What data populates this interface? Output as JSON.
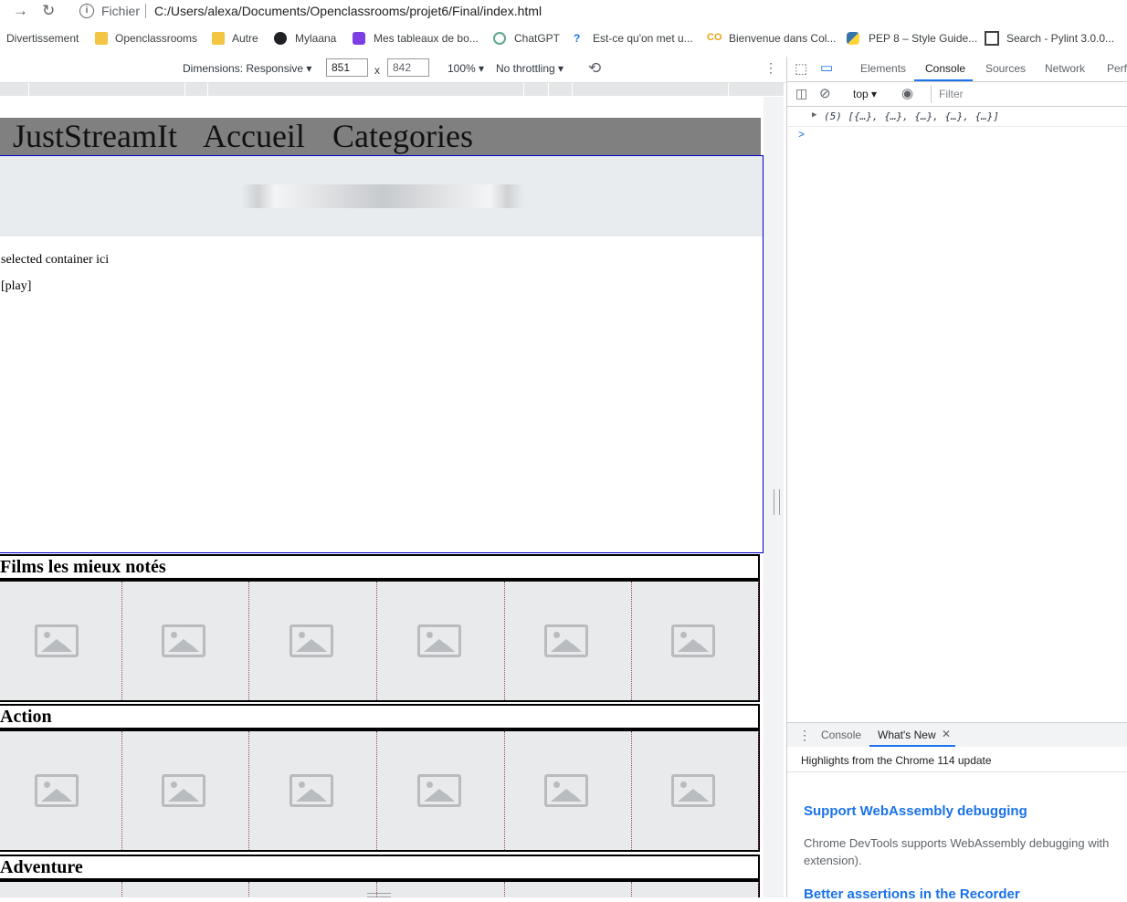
{
  "browser": {
    "url_scheme_label": "Fichier",
    "url": "C:/Users/alexa/Documents/Openclassrooms/projet6/Final/index.html",
    "bookmarks": [
      {
        "label": "Divertissement"
      },
      {
        "label": "Openclassrooms"
      },
      {
        "label": "Autre"
      },
      {
        "label": "Mylaana"
      },
      {
        "label": "Mes tableaux de bo..."
      },
      {
        "label": "ChatGPT"
      },
      {
        "label": "Est-ce qu'on met u..."
      },
      {
        "label": "Bienvenue dans Col..."
      },
      {
        "label": "PEP 8 – Style Guide..."
      },
      {
        "label": "Search - Pylint 3.0.0..."
      }
    ]
  },
  "device_toolbar": {
    "dimensions_label": "Dimensions: Responsive",
    "width": "851",
    "times": "x",
    "height": "842",
    "zoom": "100%",
    "throttling": "No throttling"
  },
  "page": {
    "nav": {
      "brand": "JustStreamIt",
      "home": "Accueil",
      "categories": "Categories"
    },
    "hero": {
      "text": "selected container ici",
      "play": "[play]"
    },
    "sections": [
      {
        "title": "Films les mieux notés"
      },
      {
        "title": "Action"
      },
      {
        "title": "Adventure"
      }
    ]
  },
  "devtools": {
    "tabs": [
      "Elements",
      "Console",
      "Sources",
      "Network",
      "Perfo"
    ],
    "active_tab": "Console",
    "context": "top",
    "filter_placeholder": "Filter",
    "log_entry": "(5) [{…}, {…}, {…}, {…}, {…}]",
    "prompt": ">",
    "drawer": {
      "tabs": [
        "Console",
        "What's New"
      ],
      "active_tab": "What's New",
      "highlights": "Highlights from the Chrome 114 update",
      "heading1": "Support WebAssembly debugging",
      "body1": "Chrome DevTools supports WebAssembly debugging with",
      "body1b": "extension).",
      "heading2": "Better assertions in the Recorder"
    }
  },
  "colors": {
    "nav_bg": "#808080",
    "hero_border": "#0000cc",
    "link_blue": "#1a73e8",
    "placeholder_bg": "#e8eaec"
  }
}
